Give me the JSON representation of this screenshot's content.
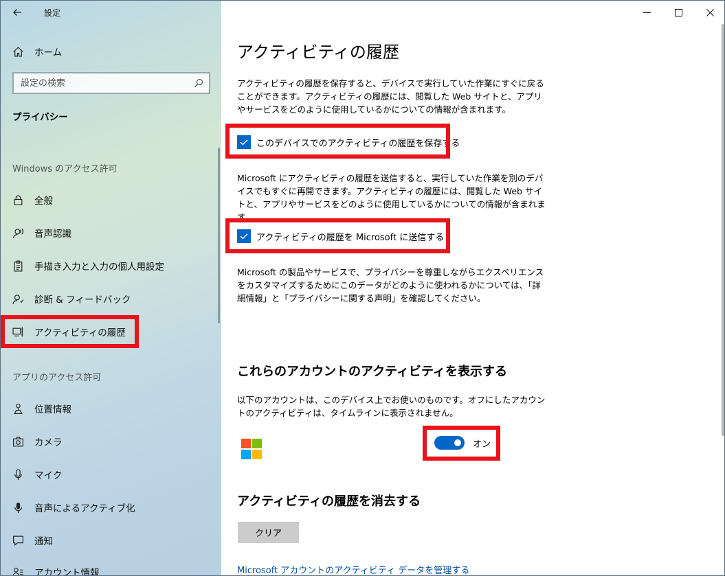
{
  "window": {
    "title": "設定",
    "back_icon": "back-arrow-icon",
    "controls": [
      "minimize-icon",
      "maximize-icon",
      "close-icon"
    ]
  },
  "sidebar": {
    "home_label": "ホーム",
    "search_placeholder": "設定の検索",
    "category": "プライバシー",
    "section_windows": "Windows のアクセス許可",
    "windows_items": [
      {
        "label": "全般",
        "icon": "lock-icon"
      },
      {
        "label": "音声認識",
        "icon": "speech-icon"
      },
      {
        "label": "手描き入力と入力の個人用設定",
        "icon": "clipboard-icon"
      },
      {
        "label": "診断 & フィードバック",
        "icon": "feedback-icon"
      },
      {
        "label": "アクティビティの履歴",
        "icon": "timeline-icon",
        "selected": true
      }
    ],
    "section_apps": "アプリのアクセス許可",
    "app_items": [
      {
        "label": "位置情報",
        "icon": "location-icon"
      },
      {
        "label": "カメラ",
        "icon": "camera-icon"
      },
      {
        "label": "マイク",
        "icon": "microphone-icon"
      },
      {
        "label": "音声によるアクティブ化",
        "icon": "voice-activation-icon"
      },
      {
        "label": "通知",
        "icon": "notification-icon"
      },
      {
        "label": "アカウント情報",
        "icon": "account-info-icon"
      }
    ]
  },
  "main": {
    "title": "アクティビティの履歴",
    "desc1": "アクティビティの履歴を保存すると、デバイスで実行していた作業にすぐに戻ることができます。アクティビティの履歴には、閲覧した Web サイトと、アプリやサービスをどのように使用しているかについての情報が含まれます。",
    "checkbox1_label": "このデバイスでのアクティビティの履歴を保存する",
    "checkbox1_checked": true,
    "desc2": "Microsoft にアクティビティの履歴を送信すると、実行していた作業を別のデバイスでもすぐに再開できます。アクティビティの履歴には、閲覧した Web サイトと、アプリやサービスをどのように使用しているかについての情報が含まれます。",
    "checkbox2_label": "アクティビティの履歴を Microsoft に送信する",
    "checkbox2_checked": true,
    "desc3": "Microsoft の製品やサービスで、プライバシーを尊重しながらエクスペリエンスをカスタマイズするためにこのデータがどのように使われるかについては、「詳細情報」と「プライバシーに関する声明」を確認してください。",
    "accounts_heading": "これらのアカウントのアクティビティを表示する",
    "accounts_desc": "以下のアカウントは、このデバイス上でお使いのものです。オフにしたアカウントのアクティビティは、タイムラインに表示されません。",
    "toggle_label": "オン",
    "toggle_on": true,
    "clear_heading": "アクティビティの履歴を消去する",
    "clear_button": "クリア",
    "manage_link": "Microsoft アカウントのアクティビティ データを管理する"
  },
  "colors": {
    "accent": "#0066c7",
    "highlight": "#e8131b",
    "link": "#0050a5"
  }
}
